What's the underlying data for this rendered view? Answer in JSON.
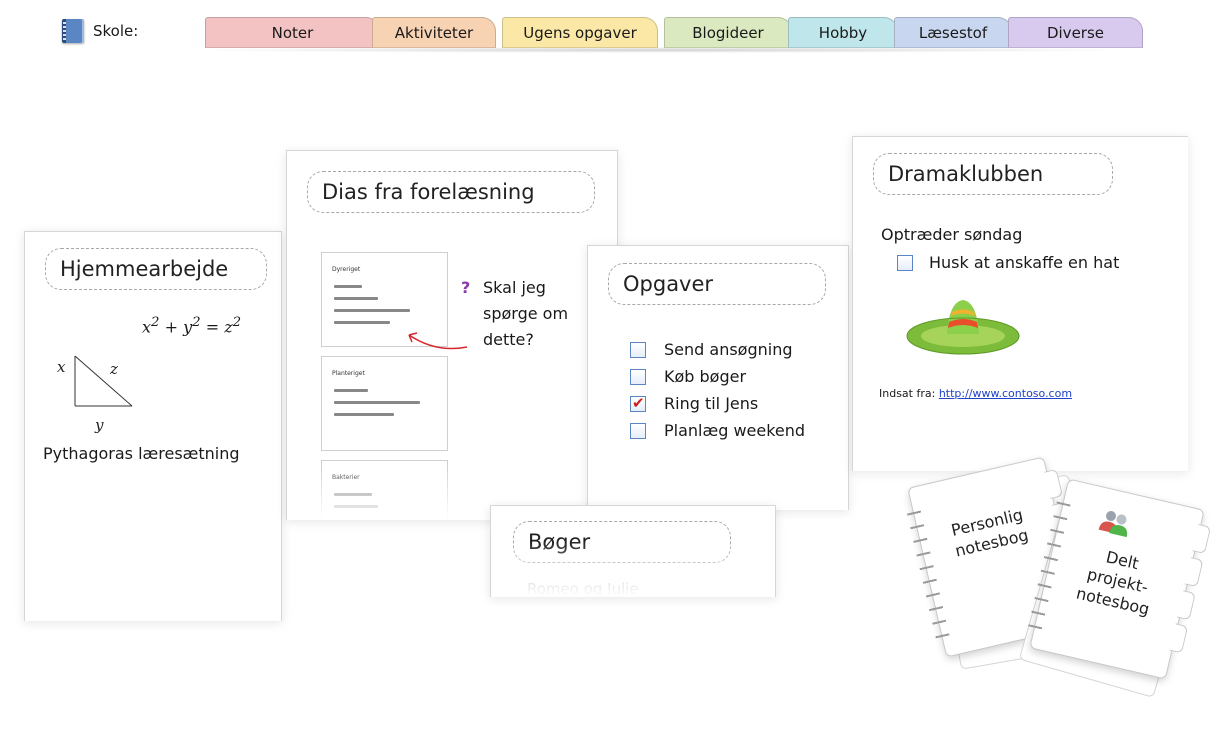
{
  "notebook": {
    "label": "Skole:",
    "icon": "notebook-icon"
  },
  "tabs": [
    {
      "label": "Noter",
      "color": "#f3c3c3"
    },
    {
      "label": "Aktiviteter",
      "color": "#f7d2b3"
    },
    {
      "label": "Ugens opgaver",
      "color": "#fbe7a6"
    },
    {
      "label": "Blogideer",
      "color": "#dbe9c0"
    },
    {
      "label": "Hobby",
      "color": "#bfe6ea"
    },
    {
      "label": "Læsestof",
      "color": "#c8d6f0"
    },
    {
      "label": "Diverse",
      "color": "#d8c9ee"
    }
  ],
  "homework": {
    "title": "Hjemmearbejde",
    "triangle_labels": {
      "x": "x",
      "y": "y",
      "z": "z"
    },
    "caption": "Pythagoras læresætning"
  },
  "lecture": {
    "title": "Dias fra forelæsning",
    "slides": [
      {
        "title": "Dyreriget"
      },
      {
        "title": "Planteriget"
      },
      {
        "title": "Bakterier"
      }
    ],
    "question_mark": "?",
    "question": "Skal jeg spørge om dette?"
  },
  "tasks": {
    "title": "Opgaver",
    "items": [
      {
        "label": "Send ansøgning",
        "checked": false
      },
      {
        "label": "Køb bøger",
        "checked": false
      },
      {
        "label": "Ring til Jens",
        "checked": true
      },
      {
        "label": "Planlæg weekend",
        "checked": false
      }
    ]
  },
  "books": {
    "title": "Bøger",
    "first_item": "Romeo og Julie"
  },
  "drama": {
    "title": "Dramaklubben",
    "subtitle": "Optræder søndag",
    "reminder": "Husk at anskaffe en hat",
    "source_label": "Indsat fra:",
    "source_link": "http://www.contoso.com"
  },
  "notebooks": {
    "personal": "Personlig notesbog",
    "shared_line1": "Delt",
    "shared_line2": "projekt-",
    "shared_line3": "notesbog"
  }
}
